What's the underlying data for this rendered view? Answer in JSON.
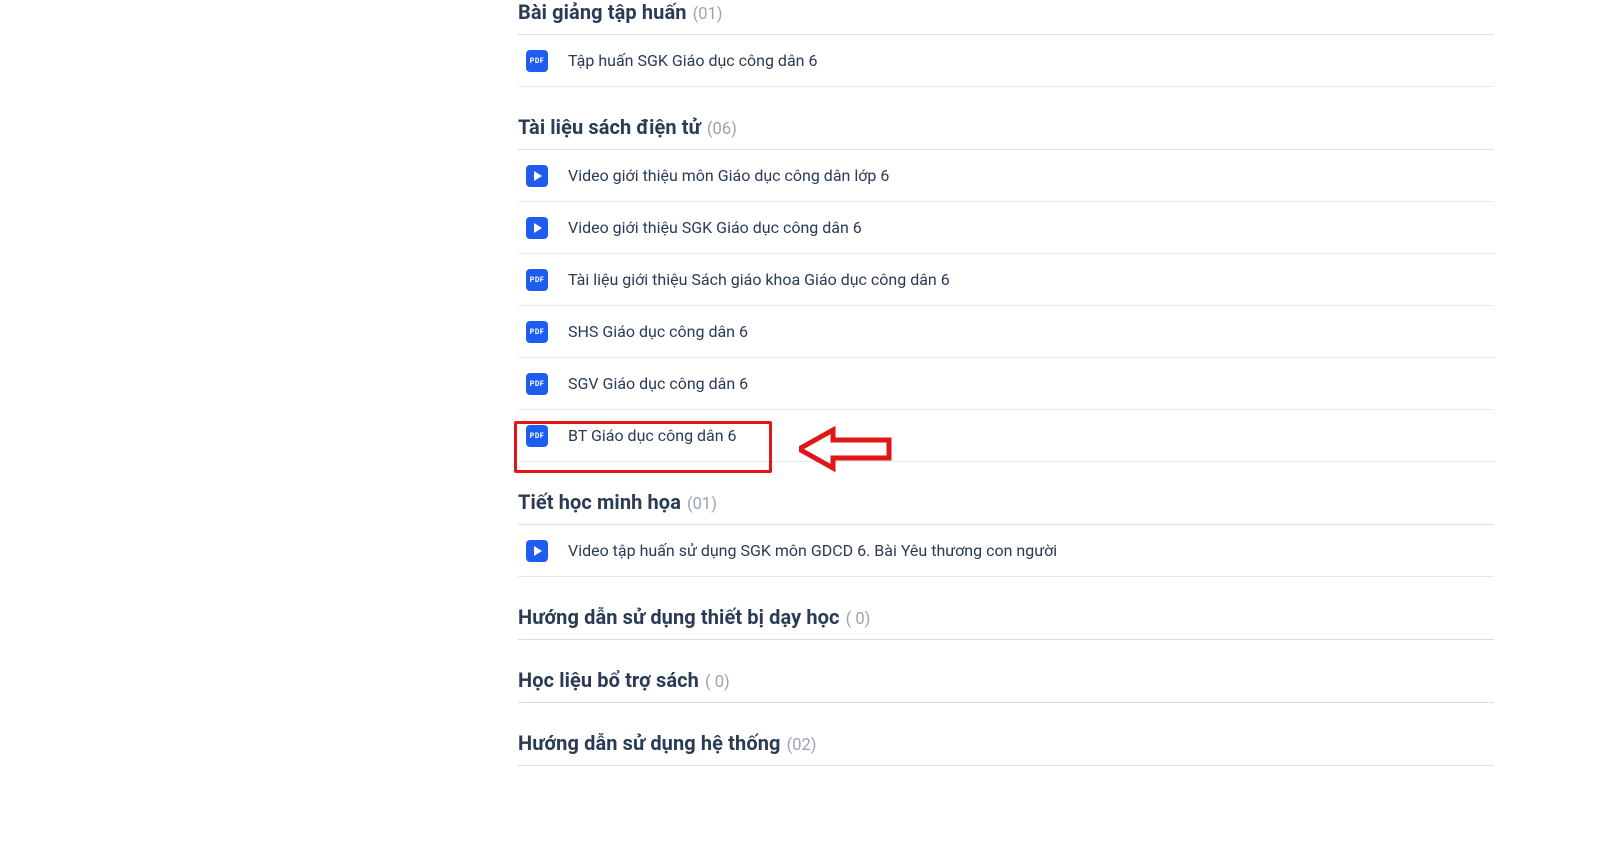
{
  "icon_labels": {
    "pdf": "PDF",
    "video": ""
  },
  "sections": [
    {
      "key": "bai_giang_tap_huan",
      "title": "Bài giảng tập huấn",
      "count": "(01)",
      "items": [
        {
          "type": "pdf",
          "label": "Tập huấn SGK Giáo dục công dân 6"
        }
      ]
    },
    {
      "key": "tai_lieu_sach_dien_tu",
      "title": "Tài liệu sách điện tử",
      "count": "(06)",
      "items": [
        {
          "type": "video",
          "label": "Video giới thiệu môn Giáo dục công dân lớp 6"
        },
        {
          "type": "video",
          "label": "Video giới thiệu SGK Giáo dục công dân 6"
        },
        {
          "type": "pdf",
          "label": "Tài liệu giới thiệu Sách giáo khoa Giáo dục công dân 6"
        },
        {
          "type": "pdf",
          "label": "SHS Giáo dục công dân 6"
        },
        {
          "type": "pdf",
          "label": "SGV Giáo dục công dân 6"
        },
        {
          "type": "pdf",
          "label": "BT Giáo dục công dân 6",
          "highlight": true
        }
      ]
    },
    {
      "key": "tiet_hoc_minh_hoa",
      "title": "Tiết học minh họa",
      "count": "(01)",
      "items": [
        {
          "type": "video",
          "label": "Video tập huấn sử dụng SGK môn GDCD 6. Bài Yêu thương con người"
        }
      ]
    },
    {
      "key": "huong_dan_su_dung_thiet_bi_day_hoc",
      "title": "Hướng dẫn sử dụng thiết bị dạy học",
      "count": "( 0)",
      "items": []
    },
    {
      "key": "hoc_lieu_bo_tro_sach",
      "title": "Học liệu bổ trợ sách",
      "count": "( 0)",
      "items": []
    },
    {
      "key": "huong_dan_su_dung_he_thong",
      "title": "Hướng dẫn sử dụng hệ thống",
      "count": "(02)",
      "items": []
    }
  ],
  "annotation": {
    "highlight_target": "tai_lieu_sach_dien_tu.items.5",
    "arrow": "left-pointing-red-arrow"
  }
}
